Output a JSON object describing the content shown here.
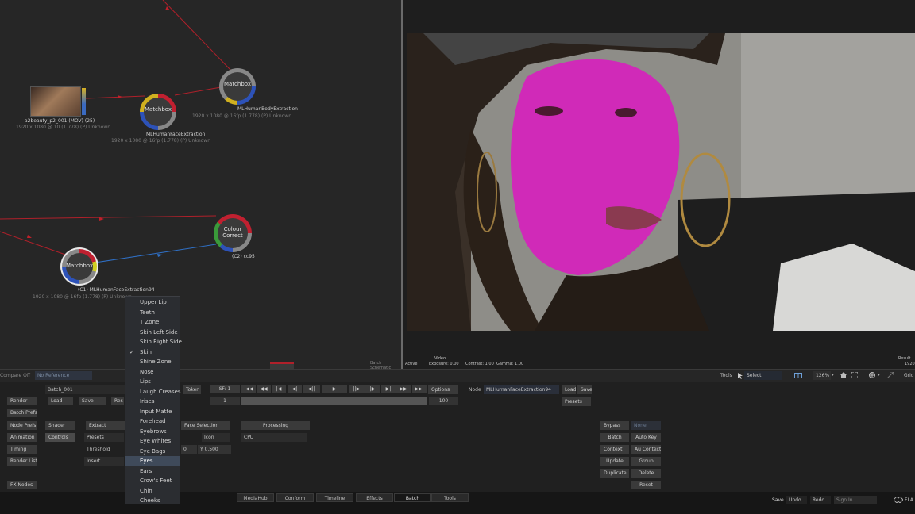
{
  "schematic": {
    "nodes": {
      "clip": {
        "label": "a2beauty_p2_001 (MOV) (25)",
        "info": "1920 x 1080 @ 10 (1.778) (P) Unknown"
      },
      "face": {
        "title": "Matchbox",
        "label": "MLHumanFaceExtraction",
        "info": "1920 x 1080 @ 16fp (1.778) (P) Unknown"
      },
      "body": {
        "title": "Matchbox",
        "label": "MLHumanBodyExtraction",
        "info": "1920 x 1080 @ 16fp (1.778) (P) Unknown"
      },
      "colour": {
        "title1": "Colour",
        "title2": "Correct",
        "label": "(C2) cc95"
      },
      "face94": {
        "title": "Matchbox",
        "label": "(C1) MLHumanFaceExtraction94",
        "info": "1920 x 1080 @ 16fp (1.778) (P) Unknown"
      }
    },
    "footer": "Batch Schematic"
  },
  "viewer": {
    "info": {
      "video": "Video",
      "active": "Active",
      "exposure": "Exposure: 0.00",
      "contrast": "Contrast: 1.00",
      "gamma": "Gamma: 1.00",
      "result": "Result",
      "res": "1920"
    }
  },
  "menu": {
    "items": [
      "Upper Lip",
      "Teeth",
      "T Zone",
      "Skin Left Side",
      "Skin Right Side",
      "Skin",
      "Shine Zone",
      "Nose",
      "Lips",
      "Laugh Creases",
      "Irises",
      "Input Matte",
      "Forehead",
      "Eyebrows",
      "Eye Whites",
      "Eye Bags",
      "Eyes",
      "Ears",
      "Crow's Feet",
      "Chin",
      "Cheeks"
    ],
    "checked": "✓",
    "hovered_index": 16
  },
  "toolbar": {
    "compare": "Compare Off",
    "reference": "No Reference",
    "tools": "Tools",
    "select": "Select",
    "zoom": "126%",
    "grid": "Grid"
  },
  "panel": {
    "render": "Render",
    "batch_name": "Batch_001",
    "load": "Load",
    "save": "Save",
    "reset": "Res",
    "token": "Token",
    "sf": "SF: 1",
    "frame_start": "1",
    "frame_end": "100",
    "options": "Options",
    "node_label": "Node",
    "node_name": "MLHumanFaceExtraction94",
    "node_load": "Load",
    "node_save": "Save",
    "presets_btn": "Presets",
    "batch_prefs": "Batch Prefs",
    "node_prefs": "Node Prefs",
    "animation": "Animation",
    "timing": "Timing",
    "render_list": "Render List",
    "fx_nodes": "FX Nodes",
    "shader": "Shader",
    "controls": "Controls",
    "extract_tab": "Extract",
    "face_selection_tab": "Face Selection",
    "processing_tab": "Processing",
    "presets": "Presets",
    "threshold": "Threshold",
    "insert": "Insert",
    "icon": "Icon",
    "cpu": "CPU",
    "x_val": "0",
    "y_val": "Y 0.500",
    "bypass": "Bypass",
    "none": "None",
    "batch": "Batch",
    "auto_key": "Auto Key",
    "context": "Context",
    "au_context": "Au Context",
    "update": "Update",
    "group": "Group",
    "duplicate": "Duplicate",
    "delete": "Delete",
    "reset_btn": "Reset"
  },
  "bottom_tabs": [
    "MediaHub",
    "Conform",
    "Timeline",
    "Effects",
    "Batch",
    "Tools"
  ],
  "active_tab": "Batch",
  "bottom_right": {
    "save": "Save",
    "undo": "Undo",
    "redo": "Redo",
    "sign_in": "Sign In",
    "brand": "FLA"
  },
  "colors": {
    "link_red": "#c0202a",
    "link_blue": "#2f6fc4",
    "skin_matte": "#d02ab8"
  }
}
